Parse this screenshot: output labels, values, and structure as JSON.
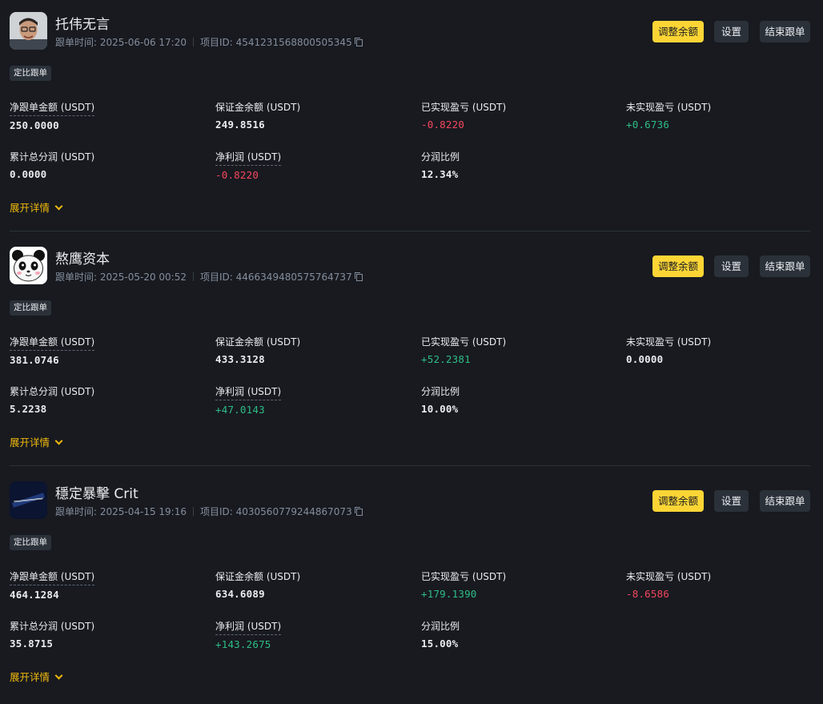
{
  "cards": [
    {
      "name": "托伟无言",
      "follow_time": "跟单时间: 2025-06-06 17:20",
      "project_id": "项目ID: 454123156880050534​5",
      "badge": "定比跟单",
      "buttons": {
        "adjust": "调整余额",
        "settings": "设置",
        "end": "结束跟单"
      },
      "stats": [
        {
          "label": "净跟单金额 (USDT)",
          "value": "250.0000",
          "tone": "normal"
        },
        {
          "label": "保证金余额 (USDT)",
          "value": "249.8516",
          "tone": "normal"
        },
        {
          "label": "已实现盈亏 (USDT)",
          "value": "-0.8220",
          "tone": "neg"
        },
        {
          "label": "未实现盈亏 (USDT)",
          "value": "+0.6736",
          "tone": "pos"
        },
        {
          "label": "累计总分润 (USDT)",
          "value": "0.0000",
          "tone": "normal"
        },
        {
          "label": "净利润 (USDT)",
          "value": "-0.8220",
          "tone": "neg"
        },
        {
          "label": "分润比例",
          "value": "12.34%",
          "tone": "normal"
        }
      ],
      "expand": "展开详情"
    },
    {
      "name": "熬鹰资本",
      "follow_time": "跟单时间: 2025-05-20 00:52",
      "project_id": "项目ID: 4466349480575764737",
      "badge": "定比跟单",
      "buttons": {
        "adjust": "调整余额",
        "settings": "设置",
        "end": "结束跟单"
      },
      "stats": [
        {
          "label": "净跟单金额 (USDT)",
          "value": "381.0746",
          "tone": "normal"
        },
        {
          "label": "保证金余额 (USDT)",
          "value": "433.3128",
          "tone": "normal"
        },
        {
          "label": "已实现盈亏 (USDT)",
          "value": "+52.2381",
          "tone": "pos"
        },
        {
          "label": "未实现盈亏 (USDT)",
          "value": "0.0000",
          "tone": "normal"
        },
        {
          "label": "累计总分润 (USDT)",
          "value": "5.2238",
          "tone": "normal"
        },
        {
          "label": "净利润 (USDT)",
          "value": "+47.0143",
          "tone": "pos"
        },
        {
          "label": "分润比例",
          "value": "10.00%",
          "tone": "normal"
        }
      ],
      "expand": "展开详情"
    },
    {
      "name": "穩定暴擊 Crit",
      "follow_time": "跟单时间: 2025-04-15 19:16",
      "project_id": "项目ID: 4030560779244867073",
      "badge": "定比跟单",
      "buttons": {
        "adjust": "调整余额",
        "settings": "设置",
        "end": "结束跟单"
      },
      "stats": [
        {
          "label": "净跟单金额 (USDT)",
          "value": "464.1284",
          "tone": "normal"
        },
        {
          "label": "保证金余额 (USDT)",
          "value": "634.6089",
          "tone": "normal"
        },
        {
          "label": "已实现盈亏 (USDT)",
          "value": "+179.1390",
          "tone": "pos"
        },
        {
          "label": "未实现盈亏 (USDT)",
          "value": "-8.6586",
          "tone": "neg"
        },
        {
          "label": "累计总分润 (USDT)",
          "value": "35.8715",
          "tone": "normal"
        },
        {
          "label": "净利润 (USDT)",
          "value": "+143.2675",
          "tone": "pos"
        },
        {
          "label": "分润比例",
          "value": "15.00%",
          "tone": "normal"
        }
      ],
      "expand": "展开详情"
    }
  ],
  "colors": {
    "accent": "#fcd535",
    "positive": "#2ebd85",
    "negative": "#f6465d",
    "background": "#181a20"
  }
}
